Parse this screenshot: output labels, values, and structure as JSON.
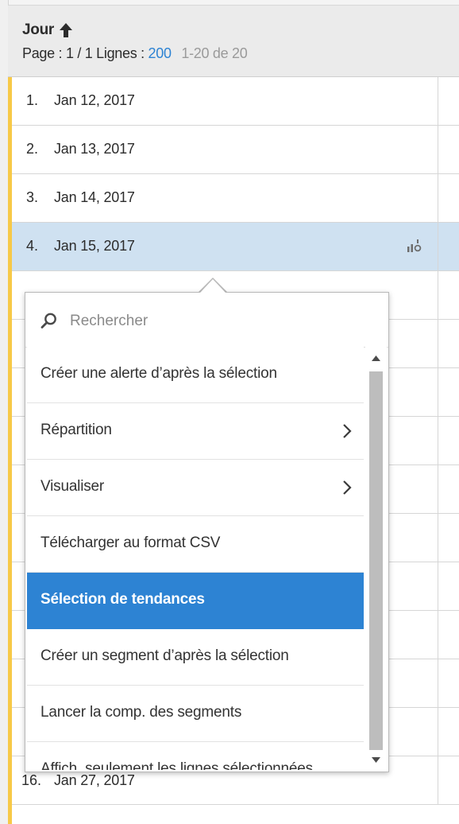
{
  "header": {
    "column_title": "Jour",
    "page_label": "Page : 1 / 1",
    "rows_label": "Lignes :",
    "rows_count": "200",
    "range": "1-20 de 20"
  },
  "rows": [
    {
      "num": "1.",
      "date": "Jan 12, 2017"
    },
    {
      "num": "2.",
      "date": "Jan 13, 2017"
    },
    {
      "num": "3.",
      "date": "Jan 14, 2017"
    },
    {
      "num": "4.",
      "date": "Jan 15, 2017"
    },
    {
      "num": "16.",
      "date": "Jan 27, 2017"
    }
  ],
  "menu": {
    "search_placeholder": "Rechercher",
    "items": [
      {
        "label": "Créer une alerte d’après la sélection"
      },
      {
        "label": "Répartition"
      },
      {
        "label": "Visualiser"
      },
      {
        "label": "Télécharger au format CSV"
      },
      {
        "label": "Sélection de tendances"
      },
      {
        "label": "Créer un segment d’après la sélection"
      },
      {
        "label": "Lancer la comp. des segments"
      },
      {
        "label": "Affich. seulement les lignes sélectionnées"
      }
    ]
  },
  "colors": {
    "accent": "#f7c948",
    "selected_row": "#cfe1f1",
    "highlight": "#2d83d3",
    "link_blue": "#2d83d3"
  },
  "icons": {
    "sort": "arrow-up-icon",
    "row_action": "visualize-icon",
    "search": "search-icon",
    "submenu": "chevron-right-icon"
  }
}
